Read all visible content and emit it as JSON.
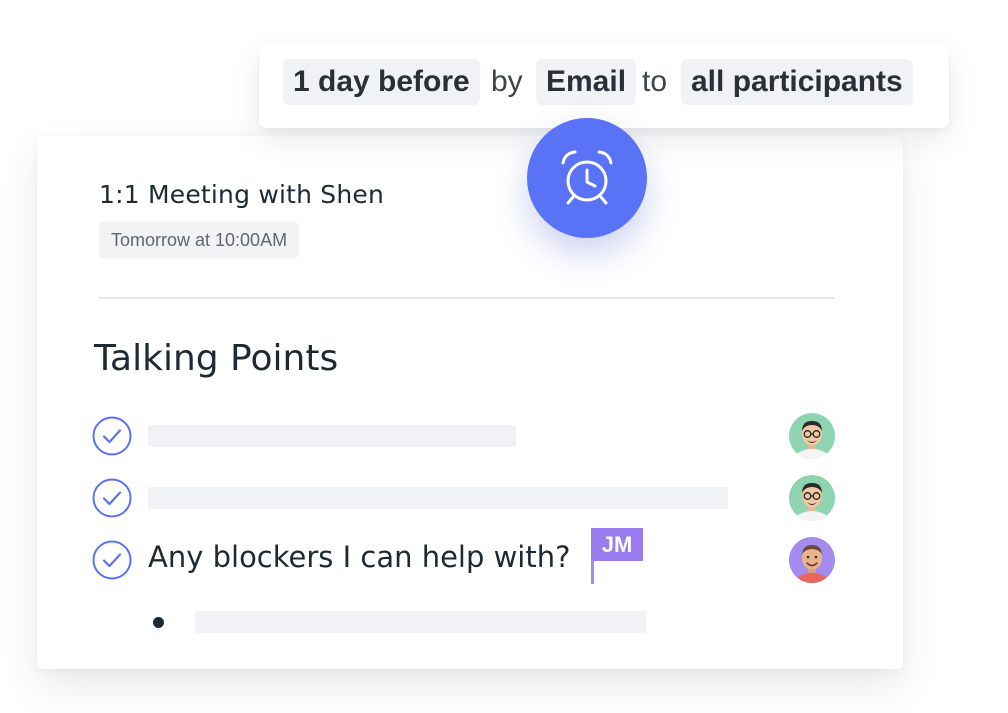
{
  "reminder": {
    "timing": "1 day before",
    "joiner_by": "by",
    "channel": "Email",
    "joiner_to": "to",
    "recipients": "all participants",
    "icon": "alarm-clock-icon",
    "icon_color": "#5a72f5"
  },
  "meeting": {
    "title": "1:1 Meeting with Shen",
    "time": "Tomorrow at 10:00AM"
  },
  "talking_points": {
    "heading": "Talking Points",
    "items": [
      {
        "text": "",
        "checked": true,
        "avatar": "avatar-man-glasses"
      },
      {
        "text": "",
        "checked": true,
        "avatar": "avatar-man-glasses"
      },
      {
        "text": "Any blockers I can help with?",
        "checked": true,
        "avatar": "avatar-man-smiling",
        "flag": "JM"
      }
    ],
    "sub_bullet": {
      "text": ""
    }
  },
  "colors": {
    "accent": "#5a72f5",
    "check": "#5a72f5",
    "flag": "#9b7cf0",
    "avatar_bg_green": "#8fd4b0",
    "avatar_bg_purple": "#a48bf0"
  }
}
